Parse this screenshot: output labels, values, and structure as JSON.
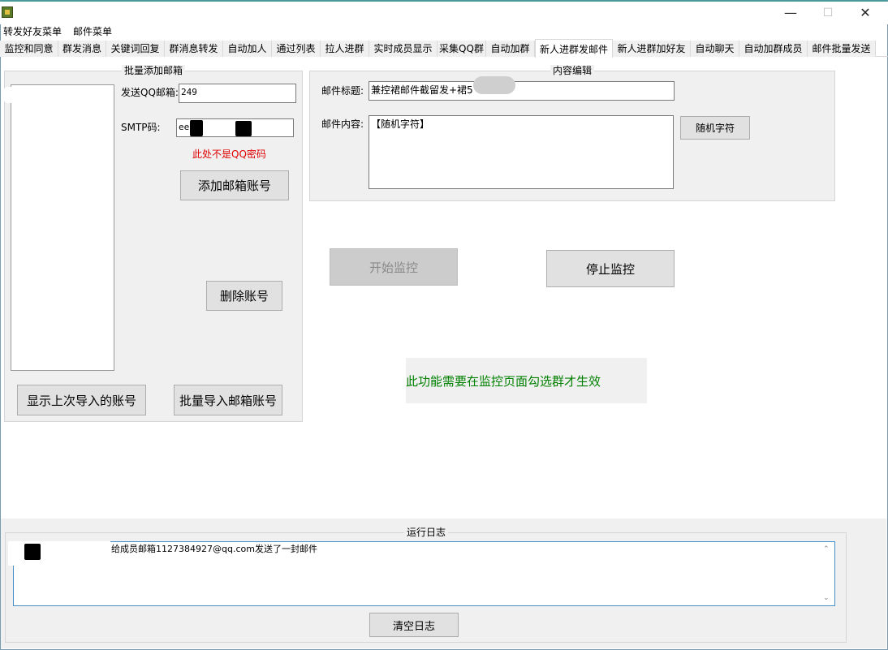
{
  "window": {
    "minimize_glyph": "—",
    "maximize_glyph": "☐",
    "close_glyph": "✕"
  },
  "menu": [
    "转发好友菜单",
    "邮件菜单"
  ],
  "tabs": [
    "监控和同意",
    "群发消息",
    "关键词回复",
    "群消息转发",
    "自动加人",
    "通过列表",
    "拉人进群",
    "实时成员显示",
    "采集QQ群",
    "自动加群",
    "新人进群发邮件",
    "新人进群加好友",
    "自动聊天",
    "自动加群成员",
    "邮件批量发送"
  ],
  "active_tab": "新人进群发邮件",
  "batch_add": {
    "title": "批量添加邮箱",
    "qq_email_label": "发送QQ邮箱:",
    "qq_email_value": "249",
    "smtp_label": "SMTP码:",
    "smtp_value": "ee",
    "warning": "此处不是QQ密码",
    "add_button": "添加邮箱账号",
    "delete_button": "删除账号",
    "show_last_button": "显示上次导入的账号",
    "batch_import_button": "批量导入邮箱账号"
  },
  "content_edit": {
    "title": "内容编辑",
    "subject_label": "邮件标题:",
    "subject_value": "兼控裙邮件截留发+裙56",
    "body_label": "邮件内容:",
    "body_value": "【随机字符】",
    "random_button": "随机字符"
  },
  "controls": {
    "start_button": "开始监控",
    "stop_button": "停止监控",
    "notice": "此功能需要在监控页面勾选群才生效"
  },
  "log": {
    "title": "运行日志",
    "line": "给成员邮箱1127384927@qq.com发送了一封邮件",
    "clear_button": "清空日志"
  },
  "colors": {
    "warning": "#e00000",
    "notice": "#008000",
    "button_bg": "#e1e1e1",
    "panel_bg": "#f0f0f0"
  }
}
